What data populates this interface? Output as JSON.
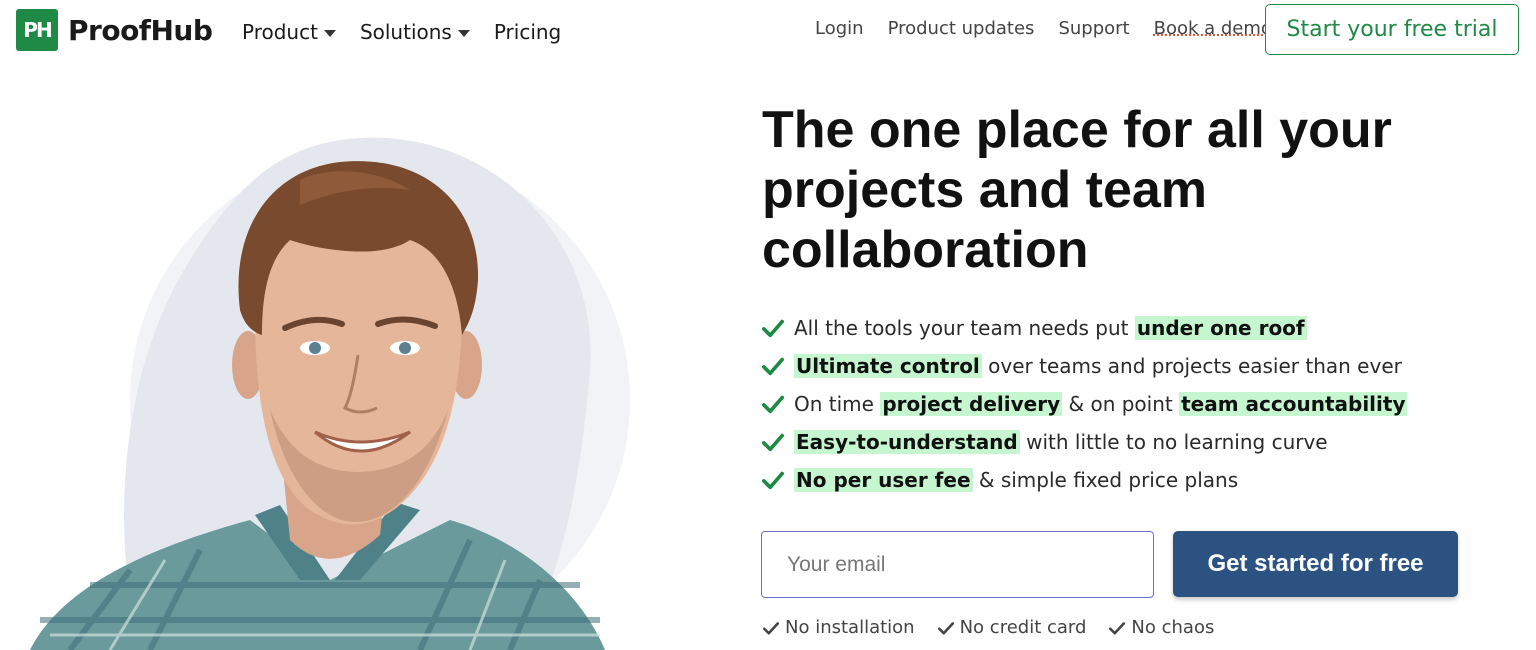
{
  "brand": {
    "mark": "PH",
    "name": "ProofHub",
    "color": "#1e8a45"
  },
  "nav": {
    "left": [
      {
        "label": "Product",
        "dropdown": true
      },
      {
        "label": "Solutions",
        "dropdown": true
      },
      {
        "label": "Pricing",
        "dropdown": false
      }
    ],
    "right": [
      "Login",
      "Product updates",
      "Support",
      "Book a demo"
    ],
    "trial_button": "Start your free trial"
  },
  "hero": {
    "headline_lines": [
      "The one place for all your",
      "projects and team",
      "collaboration"
    ],
    "image": "smiling-man-portrait",
    "bullets": [
      {
        "parts": [
          {
            "text": "All the tools your team needs put ",
            "hl": false
          },
          {
            "text": "under one roof",
            "hl": true
          }
        ]
      },
      {
        "parts": [
          {
            "text": "Ultimate control",
            "hl": true
          },
          {
            "text": " over teams and projects easier than ever",
            "hl": false
          }
        ]
      },
      {
        "parts": [
          {
            "text": "On time ",
            "hl": false
          },
          {
            "text": "project delivery",
            "hl": true
          },
          {
            "text": " & on point ",
            "hl": false
          },
          {
            "text": "team accountability",
            "hl": true
          }
        ]
      },
      {
        "parts": [
          {
            "text": "Easy-to-understand",
            "hl": true
          },
          {
            "text": " with little to no learning curve",
            "hl": false
          }
        ]
      },
      {
        "parts": [
          {
            "text": "No per user fee",
            "hl": true
          },
          {
            "text": " & simple fixed price plans",
            "hl": false
          }
        ]
      }
    ],
    "highlight_color": "#c6f6cf",
    "check_color": "#1e8a45"
  },
  "form": {
    "email_placeholder": "Your email",
    "cta_label": "Get started for free",
    "cta_color": "#2c5282"
  },
  "perks": [
    "No installation",
    "No credit card",
    "No chaos"
  ]
}
